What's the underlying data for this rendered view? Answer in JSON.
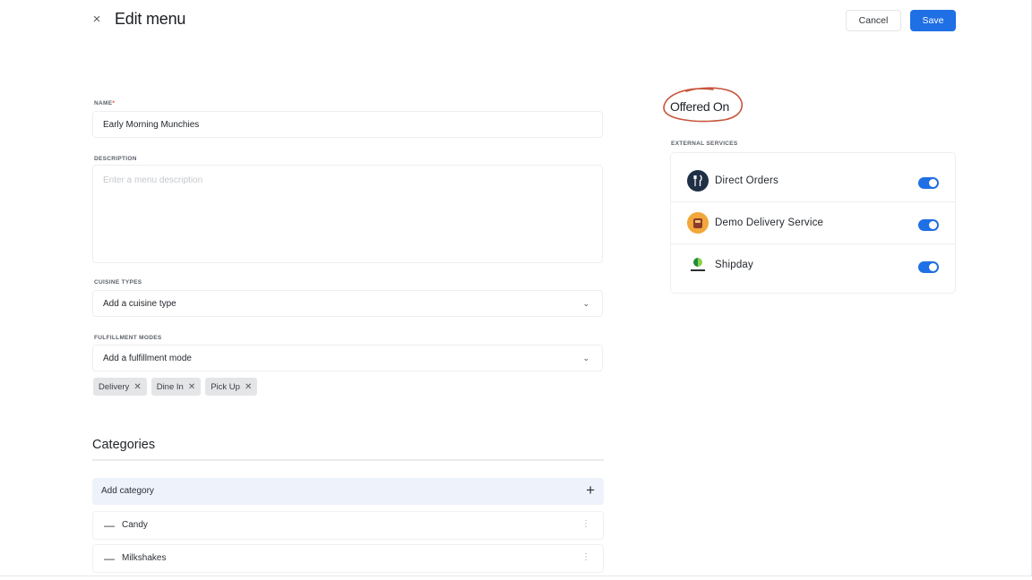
{
  "header": {
    "close_glyph": "×",
    "title": "Edit menu",
    "cancel_label": "Cancel",
    "save_label": "Save"
  },
  "form": {
    "name": {
      "label": "NAME",
      "required_mark": "*",
      "value": "Early Morning Munchies"
    },
    "description": {
      "label": "DESCRIPTION",
      "placeholder": "Enter a menu description"
    },
    "cuisine_types": {
      "label": "CUISINE TYPES",
      "value": "Add a cuisine type"
    },
    "fulfillment_modes": {
      "label": "FULFILLMENT MODES",
      "value": "Add a fulfillment mode"
    },
    "chips": [
      {
        "label": "Delivery"
      },
      {
        "label": "Dine In"
      },
      {
        "label": "Pick Up"
      }
    ]
  },
  "categories": {
    "title": "Categories",
    "add_label": "Add category",
    "items": [
      {
        "name": "Candy"
      },
      {
        "name": "Milkshakes"
      }
    ]
  },
  "offered_on": {
    "title": "Offered On",
    "annotation_color": "#c8553a",
    "external_label": "EXTERNAL SERVICES",
    "services": [
      {
        "name": "Direct Orders",
        "icon": "fork-knife-icon",
        "enabled": true
      },
      {
        "name": "Demo Delivery Service",
        "icon": "delivery-bag-icon",
        "enabled": true
      },
      {
        "name": "Shipday",
        "icon": "shipday-logo-icon",
        "enabled": true
      }
    ]
  },
  "colors": {
    "accent": "#1f6fe5",
    "toggle_on": "#1f6fe5"
  }
}
